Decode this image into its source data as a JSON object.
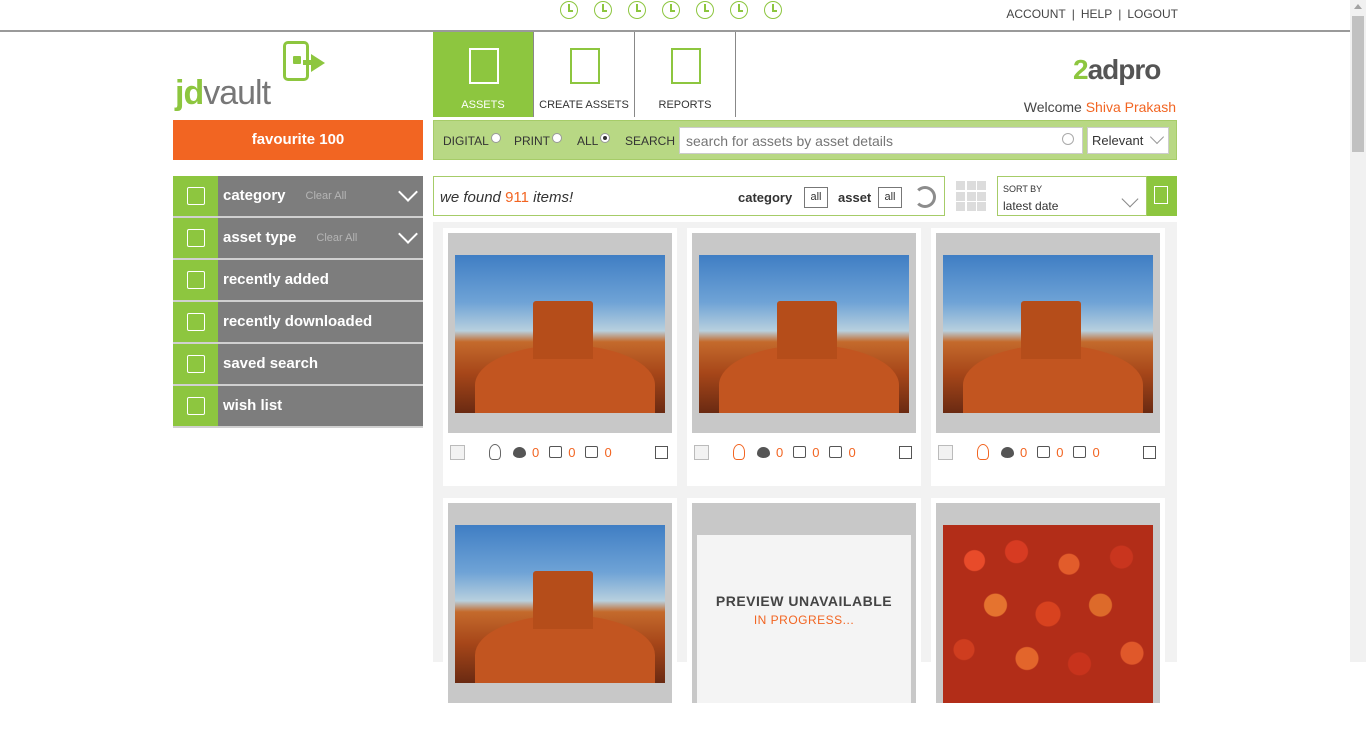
{
  "top": {
    "links": [
      "ACCOUNT",
      "HELP",
      "LOGOUT"
    ],
    "separator": "|"
  },
  "logo": {
    "prefix": "jd",
    "suffix": "vault"
  },
  "favourite": {
    "label": "favourite 100"
  },
  "sidebar": {
    "items": [
      {
        "label": "category",
        "clear": "Clear All",
        "icon": "layers-icon"
      },
      {
        "label": "asset type",
        "clear": "Clear All",
        "icon": "tray-icon"
      },
      {
        "label": "recently added",
        "icon": "plus-box-icon"
      },
      {
        "label": "recently downloaded",
        "icon": "download-icon"
      },
      {
        "label": "saved search",
        "icon": "search-doc-icon"
      },
      {
        "label": "wish list",
        "icon": "wishlist-icon"
      }
    ]
  },
  "tabs": [
    {
      "label": "ASSETS",
      "active": true,
      "icon": "documents-icon"
    },
    {
      "label": "CREATE ASSETS",
      "active": false,
      "icon": "edit-doc-icon"
    },
    {
      "label": "REPORTS",
      "active": false,
      "icon": "chart-board-icon"
    }
  ],
  "brand": {
    "pre": "2",
    "post": "adpro"
  },
  "welcome": {
    "label": "Welcome",
    "name": "Shiva Prakash"
  },
  "filter": {
    "digital": "DIGITAL",
    "print": "PRINT",
    "all": "ALL",
    "search": "SEARCH",
    "selected": "ALL",
    "search_placeholder": "search for assets by asset details",
    "sort_relevance": "Relevant"
  },
  "results": {
    "prefix": "we found",
    "count": "911",
    "suffix": "items!",
    "category_label": "category",
    "category_value": "all",
    "asset_label": "asset",
    "asset_value": "all"
  },
  "sort": {
    "label": "SORT BY",
    "value": "latest date"
  },
  "cards": [
    {
      "type": "photo",
      "bulb": "gray",
      "likes": "0",
      "ups": "0",
      "downs": "0"
    },
    {
      "type": "photo",
      "bulb": "orange",
      "likes": "0",
      "ups": "0",
      "downs": "0"
    },
    {
      "type": "photo",
      "bulb": "orange",
      "likes": "0",
      "ups": "0",
      "downs": "0"
    },
    {
      "type": "photo"
    },
    {
      "type": "preview",
      "line1": "PREVIEW UNAVAILABLE",
      "line2": "IN PROGRESS..."
    },
    {
      "type": "apples"
    }
  ],
  "colors": {
    "green": "#8dc63f",
    "orange": "#f26522",
    "gray": "#7d7d7d"
  }
}
